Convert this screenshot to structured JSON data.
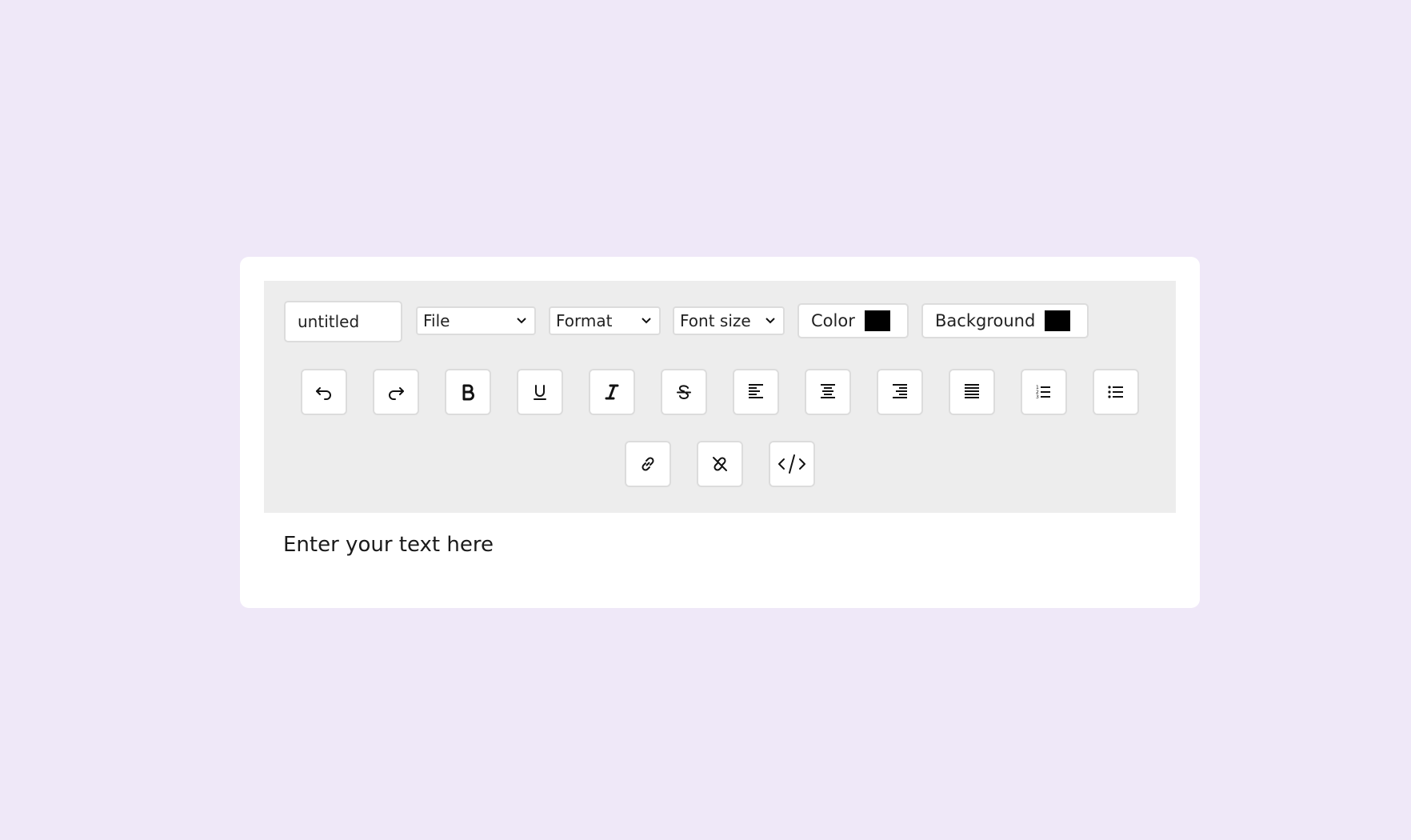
{
  "editor": {
    "filename": "untitled",
    "file_select": "File",
    "format_select": "Format",
    "font_size_select": "Font size",
    "color_label": "Color",
    "color_value": "#000000",
    "background_label": "Background",
    "background_value": "#000000",
    "content_text": "Enter your text here"
  },
  "toolbar_buttons": [
    "undo-icon",
    "redo-icon",
    "bold-icon",
    "underline-icon",
    "italic-icon",
    "strikethrough-icon",
    "align-left-icon",
    "align-center-icon",
    "align-right-icon",
    "align-justify-icon",
    "ordered-list-icon",
    "unordered-list-icon",
    "link-icon",
    "unlink-icon",
    "code-icon"
  ],
  "colors": {
    "page_background": "#efe8f8",
    "toolbar_background": "#ededed",
    "panel_background": "#ffffff"
  }
}
